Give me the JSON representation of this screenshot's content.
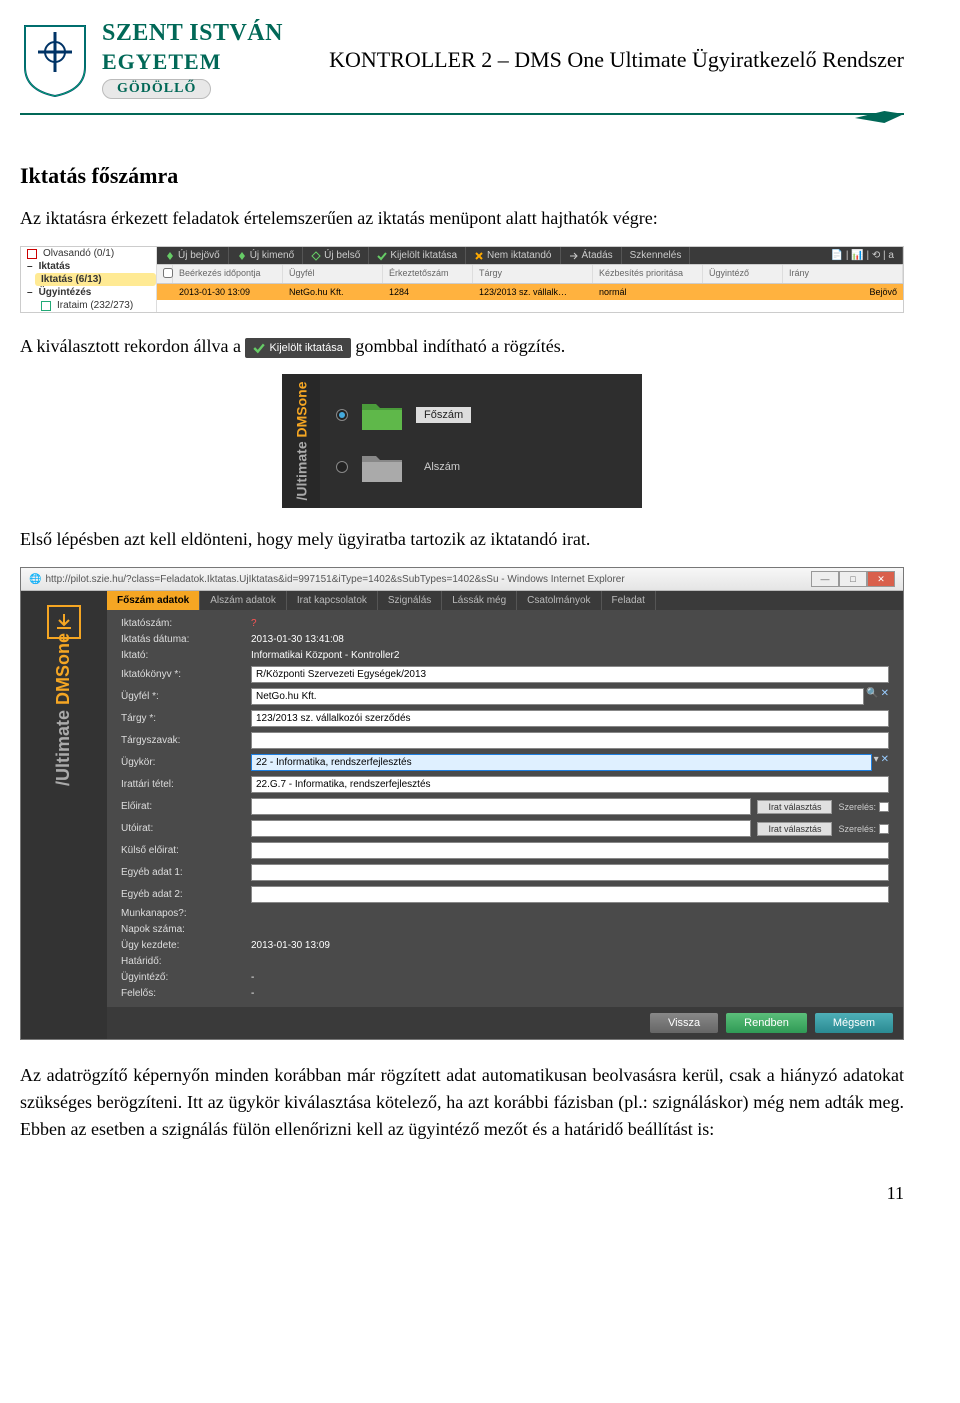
{
  "header": {
    "university1": "SZENT ISTVÁN",
    "university2": "EGYETEM",
    "location": "GÖDÖLLŐ",
    "doc_title": "KONTROLLER 2 – DMS One Ultimate Ügyiratkezelő Rendszer"
  },
  "text": {
    "h2": "Iktatás főszámra",
    "p1": "Az iktatásra érkezett feladatok értelemszerűen az iktatás menüpont alatt hajthatók végre:",
    "p2a": "A kiválasztott rekordon állva a ",
    "p2b_btn": "Kijelölt iktatása",
    "p2c": " gombbal indítható a rögzítés.",
    "p3": "Első lépésben azt kell eldönteni, hogy mely ügyiratba tartozik az iktatandó irat.",
    "p4": "Az adatrögzítő képernyőn minden korábban már rögzített adat automatikusan beolvasásra kerül, csak a hiányzó adatokat szükséges berögzíteni. Itt az ügykör kiválasztása kötelező, ha azt korábbi fázisban (pl.: szignáláskor) még nem adták meg. Ebben az esetben a szignálás fülön ellenőrizni kell az ügyintéző mezőt és a határidő beállítást is:",
    "pagenum": "11"
  },
  "ss1": {
    "left": {
      "olvasando": "Olvasandó (0/1)",
      "iktatas_parent": "Iktatás",
      "iktatas": "Iktatás (6/13)",
      "ugyintezes": "Ügyintézés",
      "irataim": "Irataim (232/273)"
    },
    "tabs": [
      "Új bejövő",
      "Új kimenő",
      "Új belső",
      "Kijelölt iktatása",
      "Nem iktatandó",
      "Átadás",
      "Szkennelés"
    ],
    "cols": [
      "",
      "Beérkezés időpontja",
      "Ügyfél",
      "Érkeztetőszám",
      "Tárgy",
      "Kézbesítés prioritása",
      "Ügyintéző",
      "Irány"
    ],
    "row": [
      "",
      "2013-01-30 13:09",
      "NetGo.hu Kft.",
      "1284",
      "123/2013 sz. vállalk…",
      "normál",
      "",
      "Bejövő"
    ]
  },
  "ss2": {
    "brand_top": "DMSone",
    "brand_bot": "/Ultimate",
    "opt1": "Főszám",
    "opt2": "Alszám"
  },
  "ss3": {
    "url": "http://pilot.szie.hu/?class=Feladatok.Iktatas.UjIktatas&id=997151&iType=1402&sSubTypes=1402&sSu - Windows Internet Explorer",
    "brand_top": "DMSone",
    "brand_bot": "/Ultimate",
    "tabs": [
      "Főszám adatok",
      "Alszám adatok",
      "Irat kapcsolatok",
      "Szignálás",
      "Lássák még",
      "Csatolmányok",
      "Feladat"
    ],
    "rows": {
      "iktatoszam_l": "Iktatószám:",
      "iktatoszam_v": "?",
      "datum_l": "Iktatás dátuma:",
      "datum_v": "2013-01-30 13:41:08",
      "iktato_l": "Iktató:",
      "iktato_v": "Informatikai Központ - Kontroller2",
      "konyv_l": "Iktatókönyv *:",
      "konyv_v": "R/Központi Szervezeti Egységek/2013",
      "ugyfel_l": "Ügyfél *:",
      "ugyfel_v": "NetGo.hu Kft.",
      "targy_l": "Tárgy *:",
      "targy_v": "123/2013 sz. vállalkozói szerződés",
      "targyszavak_l": "Tárgyszavak:",
      "ugykor_l": "Ügykör:",
      "ugykor_v": "22 - Informatika, rendszerfejlesztés",
      "irattari_l": "Irattári tétel:",
      "irattari_v": "22.G.7 - Informatika, rendszerfejlesztés",
      "eloirat_l": "Előirat:",
      "eloirat_btn": "Irat választás",
      "eloirat_chk": "Szerelés:",
      "utoirat_l": "Utóirat:",
      "utoirat_btn": "Irat választás",
      "utoirat_chk": "Szerelés:",
      "kulso_l": "Külső előirat:",
      "adat1_l": "Egyéb adat 1:",
      "adat2_l": "Egyéb adat 2:",
      "munkanapos_l": "Munkanapos?:",
      "napok_l": "Napok száma:",
      "kezdete_l": "Ügy kezdete:",
      "kezdete_v": "2013-01-30 13:09",
      "hatarido_l": "Határidő:",
      "ugyintezo_l": "Ügyintéző:",
      "ugyintezo_v": "-",
      "felelos_l": "Felelős:",
      "felelos_v": "-"
    },
    "footer": {
      "vissza": "Vissza",
      "rendben": "Rendben",
      "megsem": "Mégsem"
    }
  }
}
